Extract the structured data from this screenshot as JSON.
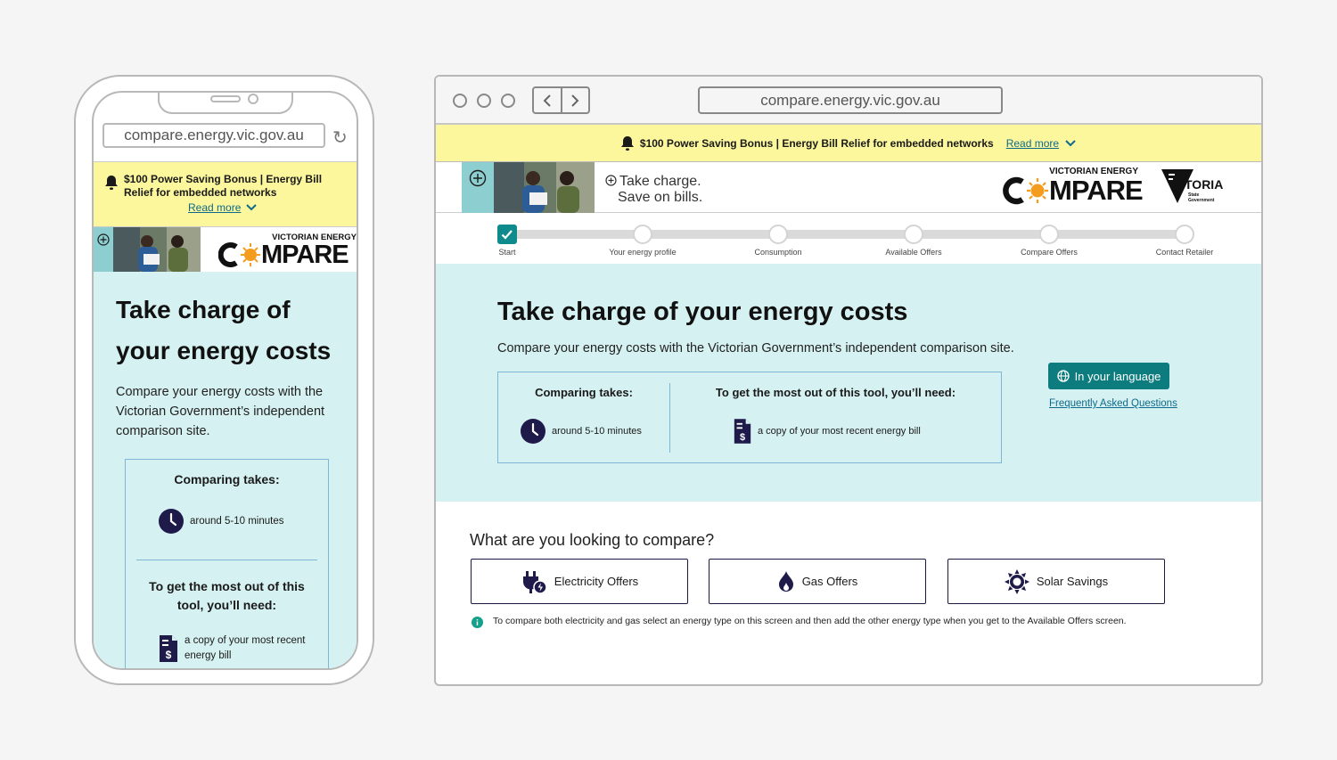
{
  "site": {
    "url": "compare.energy.vic.gov.au"
  },
  "alert": {
    "text": "$100 Power Saving Bonus | Energy Bill Relief for embedded networks",
    "read_more": "Read more"
  },
  "header": {
    "tagline_line1": "Take charge.",
    "tagline_line2": "Save on bills.",
    "logo_top": "VICTORIAN ENERGY",
    "logo_word": "MPARE",
    "vic_word": "TORIA",
    "vic_sub1": "State",
    "vic_sub2": "Government"
  },
  "steps": [
    {
      "label": "Start",
      "done": true
    },
    {
      "label": "Your energy profile",
      "done": false
    },
    {
      "label": "Consumption",
      "done": false
    },
    {
      "label": "Available Offers",
      "done": false
    },
    {
      "label": "Compare Offers",
      "done": false
    },
    {
      "label": "Contact Retailer",
      "done": false
    }
  ],
  "hero": {
    "title": "Take charge of your energy costs",
    "mobile_title_line1": "Take charge of",
    "mobile_title_line2": "your energy costs",
    "subtitle": "Compare your energy costs with the Victorian Government’s independent comparison site.",
    "comparing_heading": "Comparing takes:",
    "comparing_value": "around 5-10 minutes",
    "need_heading": "To get the most out of this tool, you’ll need:",
    "mobile_need_heading": "To get the most out of this tool, you’ll need:",
    "need_value": "a copy of your most recent energy bill",
    "language_button": "In your language",
    "faq_link": "Frequently Asked Questions"
  },
  "compare": {
    "question": "What are you looking to compare?",
    "options": [
      {
        "label": "Electricity Offers",
        "icon": "electricity-icon"
      },
      {
        "label": "Gas Offers",
        "icon": "gas-flame-icon"
      },
      {
        "label": "Solar Savings",
        "icon": "sun-icon"
      }
    ],
    "note": "To compare both electricity and gas select an energy type on this screen and then add the other energy type when you get to the Available Offers screen."
  },
  "colors": {
    "alert_bg": "#fcf79c",
    "hero_bg": "#d6f1f1",
    "accent_teal": "#0d7c7e",
    "navy": "#1e1b4b",
    "logo_orange": "#f39c1e"
  }
}
